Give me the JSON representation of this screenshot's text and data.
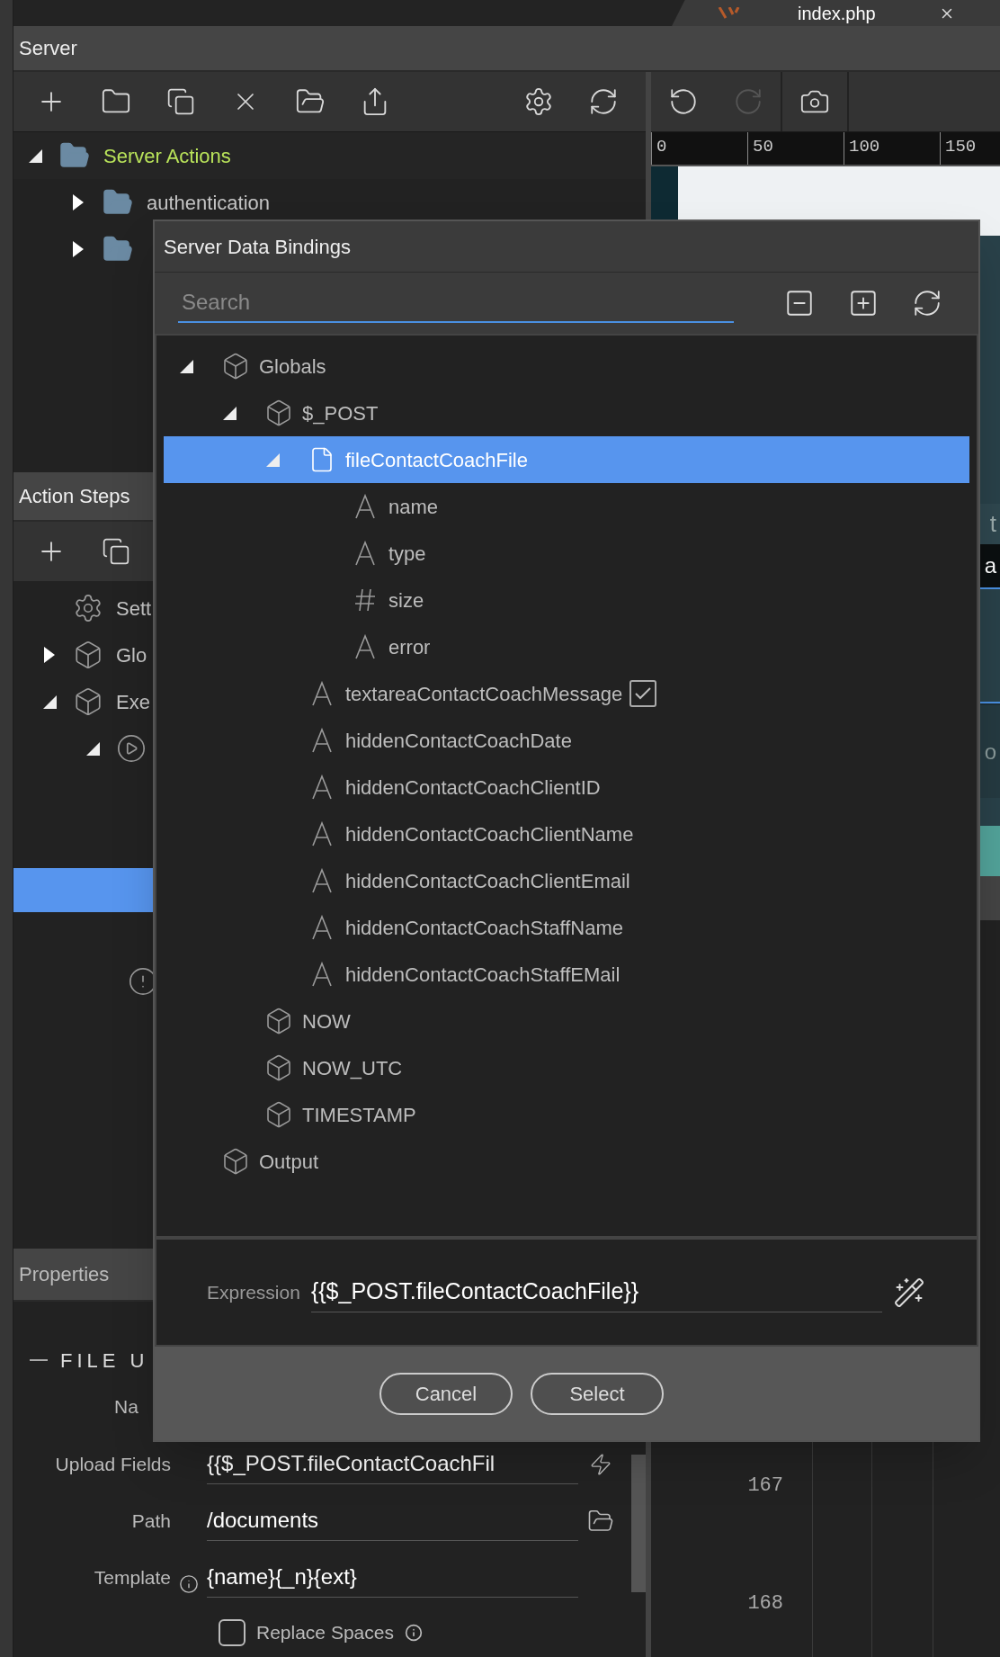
{
  "editor_tab": {
    "title": "index.php"
  },
  "server_panel": {
    "title": "Server",
    "tree": [
      {
        "label": "Server Actions",
        "selected": true,
        "expanded": true,
        "children": [
          {
            "label": "authentication",
            "selected": false,
            "expanded": false
          },
          {
            "expanded": false
          }
        ]
      }
    ]
  },
  "action_steps": {
    "title": "Action Steps",
    "steps": [
      {
        "kind": "settings",
        "label": "Sett"
      },
      {
        "kind": "object",
        "label": "Glo",
        "expanded": false
      },
      {
        "kind": "object",
        "label": "Exe",
        "expanded": true,
        "children": [
          {
            "kind": "action",
            "expanded": true
          }
        ]
      }
    ]
  },
  "properties": {
    "title": "Properties",
    "section": "FILE U",
    "name_label": "Na",
    "fields": [
      {
        "label": "Upload Fields",
        "value": "{{$_POST.fileContactCoachFil",
        "kind": "binding"
      },
      {
        "label": "Path",
        "value": "/documents",
        "kind": "folder"
      },
      {
        "label": "Template",
        "value": "{name}{_n}{ext}",
        "kind": "info"
      }
    ],
    "replace_spaces": {
      "label": "Replace Spaces",
      "checked": false
    }
  },
  "design_view": {
    "ruler_ticks": [
      "0",
      "50",
      "100",
      "150"
    ],
    "fragments": [
      "t",
      "a",
      "o"
    ],
    "line_numbers": [
      "167",
      "168"
    ]
  },
  "dialog": {
    "title": "Server Data Bindings",
    "search": {
      "placeholder": "Search"
    },
    "tree": [
      {
        "label": "Globals",
        "kind": "object",
        "expanded": true,
        "selected": false,
        "children": [
          {
            "label": "$_POST",
            "kind": "object",
            "expanded": true,
            "selected": false,
            "children": [
              {
                "label": "fileContactCoachFile",
                "kind": "file",
                "expanded": true,
                "selected": true,
                "children": [
                  {
                    "label": "name",
                    "kind": "string",
                    "selected": false
                  },
                  {
                    "label": "type",
                    "kind": "string",
                    "selected": false
                  },
                  {
                    "label": "size",
                    "kind": "number",
                    "selected": false
                  },
                  {
                    "label": "error",
                    "kind": "string",
                    "selected": false
                  }
                ]
              },
              {
                "label": "textareaContactCoachMessage",
                "kind": "string",
                "selected": false,
                "checked": true
              },
              {
                "label": "hiddenContactCoachDate",
                "kind": "string",
                "selected": false
              },
              {
                "label": "hiddenContactCoachClientID",
                "kind": "string",
                "selected": false
              },
              {
                "label": "hiddenContactCoachClientName",
                "kind": "string",
                "selected": false
              },
              {
                "label": "hiddenContactCoachClientEmail",
                "kind": "string",
                "selected": false
              },
              {
                "label": "hiddenContactCoachStaffName",
                "kind": "string",
                "selected": false
              },
              {
                "label": "hiddenContactCoachStaffEMail",
                "kind": "string",
                "selected": false
              }
            ]
          },
          {
            "label": "NOW",
            "kind": "object",
            "selected": false
          },
          {
            "label": "NOW_UTC",
            "kind": "object",
            "selected": false
          },
          {
            "label": "TIMESTAMP",
            "kind": "object",
            "selected": false
          }
        ]
      },
      {
        "label": "Output",
        "kind": "object",
        "selected": false
      }
    ],
    "expression": {
      "label": "Expression",
      "value": "{{$_POST.fileContactCoachFile}}"
    },
    "buttons": [
      "Cancel",
      "Select"
    ]
  }
}
